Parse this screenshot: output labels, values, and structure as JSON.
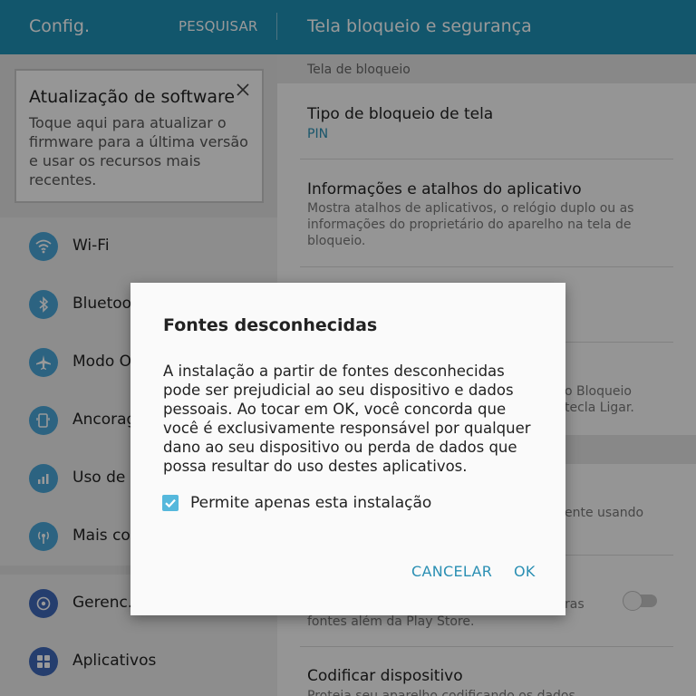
{
  "header": {
    "app_title": "Config.",
    "search_label": "PESQUISAR",
    "page_title": "Tela bloqueio e segurança"
  },
  "update_card": {
    "title": "Atualização de software",
    "body": "Toque aqui para atualizar o firmware para a última versão e usar os recursos mais recentes."
  },
  "sidebar": {
    "items": [
      {
        "label": "Wi-Fi",
        "icon": "wifi-icon",
        "color": "#4aa6d8"
      },
      {
        "label": "Bluetooth",
        "icon": "bluetooth-icon",
        "color": "#4aa6d8"
      },
      {
        "label": "Modo Offline",
        "icon": "airplane-icon",
        "color": "#4aa6d8"
      },
      {
        "label": "Ancoragem",
        "icon": "tethering-icon",
        "color": "#4aa6d8"
      },
      {
        "label": "Uso de dados",
        "icon": "data-usage-icon",
        "color": "#4aa6d8"
      },
      {
        "label": "Mais conexões",
        "icon": "more-connections-icon",
        "color": "#4aa6d8"
      },
      {
        "label": "Gerenc.",
        "icon": "manager-icon",
        "color": "#3f68b8"
      },
      {
        "label": "Aplicativos",
        "icon": "apps-icon",
        "color": "#3f68b8"
      }
    ]
  },
  "right": {
    "section1": "Tela de bloqueio",
    "lock_type": {
      "title": "Tipo de bloqueio de tela",
      "value": "PIN"
    },
    "info_shortcuts": {
      "title": "Informações e atalhos do aplicativo",
      "desc": "Mostra atalhos de aplicativos, o relógio duplo ou as informações do proprietário do aparelho na tela de bloqueio."
    },
    "partial_text_1": "o Bloqueio",
    "partial_text_2": "tecla Ligar.",
    "partial_text_3": "ente usando",
    "partial_text_4": "ras",
    "partial_text_5": "fontes além da Play Store.",
    "encrypt": {
      "title": "Codificar dispositivo",
      "desc": "Proteja seu aparelho codificando os dados."
    }
  },
  "dialog": {
    "title": "Fontes desconhecidas",
    "body": "A instalação a partir de fontes desconhecidas pode ser prejudicial ao seu dispositivo e dados pessoais. Ao tocar em OK, você concorda que você é exclusivamente responsável por qualquer dano ao seu dispositivo ou perda de dados que possa resultar do uso destes aplicativos.",
    "checkbox_label": "Permite apenas esta instalação",
    "checkbox_checked": true,
    "cancel_label": "CANCELAR",
    "ok_label": "OK"
  },
  "colors": {
    "header_bg": "#1f8fb5",
    "accent": "#2a8fb3",
    "checkbox": "#55b8dc"
  }
}
